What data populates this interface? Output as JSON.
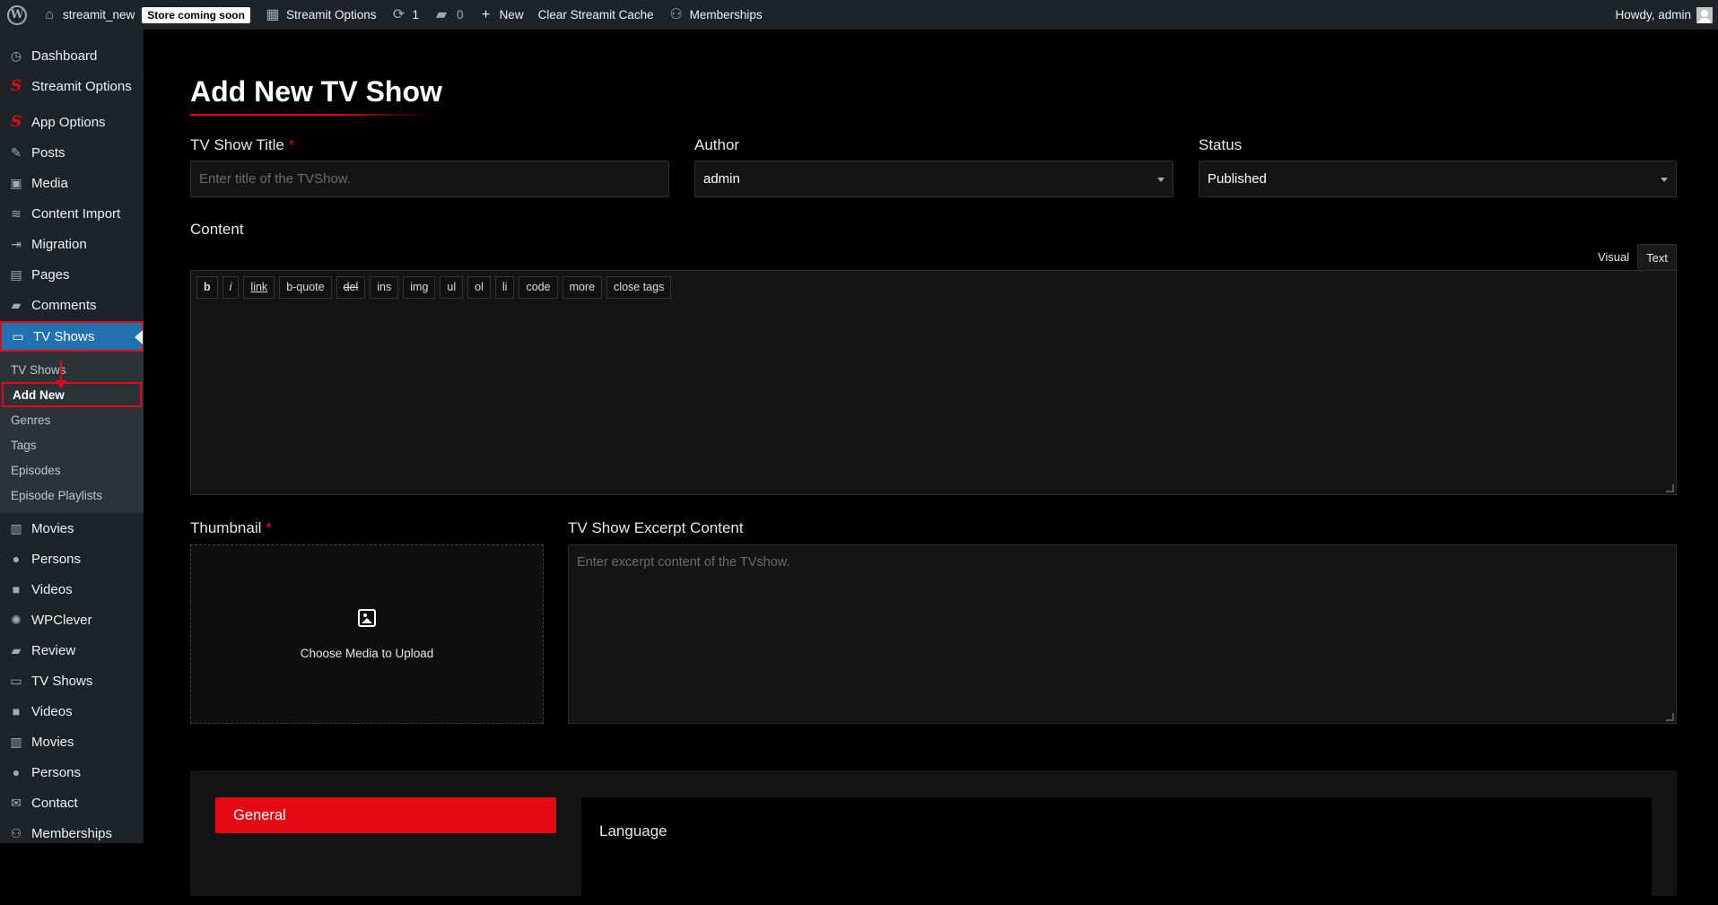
{
  "adminbar": {
    "site_name": "streamit_new",
    "store_badge": "Store coming soon",
    "streamit_options": "Streamit Options",
    "updates_count": "1",
    "comments_count": "0",
    "new_label": "New",
    "clear_cache": "Clear Streamit Cache",
    "memberships": "Memberships",
    "howdy": "Howdy, admin"
  },
  "sidebar": {
    "items_top": [
      {
        "label": "Dashboard",
        "icon": "dashboard-icon",
        "glyph": "◷"
      },
      {
        "label": "Streamit Options",
        "icon": "streamit-s-icon",
        "glyph": "S"
      },
      {
        "label": "App Options",
        "icon": "streamit-s-icon",
        "glyph": "S"
      },
      {
        "label": "Posts",
        "icon": "pushpin-icon",
        "glyph": "✎"
      },
      {
        "label": "Media",
        "icon": "media-icon",
        "glyph": "▣"
      },
      {
        "label": "Content Import",
        "icon": "database-icon",
        "glyph": "≋"
      },
      {
        "label": "Migration",
        "icon": "migrate-icon",
        "glyph": "⇥"
      },
      {
        "label": "Pages",
        "icon": "pages-icon",
        "glyph": "▤"
      },
      {
        "label": "Comments",
        "icon": "comment-icon",
        "glyph": "▰"
      }
    ],
    "active": {
      "label": "TV Shows",
      "icon": "tv-icon",
      "glyph": "▭"
    },
    "submenu": [
      "TV Shows",
      "Add New",
      "Genres",
      "Tags",
      "Episodes",
      "Episode Playlists"
    ],
    "items_bottom": [
      {
        "label": "Movies",
        "icon": "film-icon",
        "glyph": "▥"
      },
      {
        "label": "Persons",
        "icon": "person-icon",
        "glyph": "●"
      },
      {
        "label": "Videos",
        "icon": "video-icon",
        "glyph": "■"
      },
      {
        "label": "WPClever",
        "icon": "lightbulb-icon",
        "glyph": "✺"
      },
      {
        "label": "Review",
        "icon": "comment-icon",
        "glyph": "▰"
      },
      {
        "label": "TV Shows",
        "icon": "tv-icon",
        "glyph": "▭"
      },
      {
        "label": "Videos",
        "icon": "video-icon",
        "glyph": "■"
      },
      {
        "label": "Movies",
        "icon": "film-icon",
        "glyph": "▥"
      },
      {
        "label": "Persons",
        "icon": "person-icon",
        "glyph": "●"
      },
      {
        "label": "Contact",
        "icon": "mail-icon",
        "glyph": "✉"
      },
      {
        "label": "Memberships",
        "icon": "groups-icon",
        "glyph": "⚇"
      }
    ]
  },
  "page": {
    "title": "Add New TV Show",
    "title_label": "TV Show Title",
    "required_mark": "*",
    "title_placeholder": "Enter title of the TVShow.",
    "author_label": "Author",
    "author_value": "admin",
    "status_label": "Status",
    "status_value": "Published",
    "content_label": "Content",
    "tab_visual": "Visual",
    "tab_text": "Text",
    "quicktags": [
      "b",
      "i",
      "link",
      "b-quote",
      "del",
      "ins",
      "img",
      "ul",
      "ol",
      "li",
      "code",
      "more",
      "close tags"
    ],
    "thumbnail_label": "Thumbnail",
    "thumbnail_text": "Choose Media to Upload",
    "excerpt_label": "TV Show Excerpt Content",
    "excerpt_placeholder": "Enter excerpt content of the TVshow.",
    "general_tab": "General",
    "language_label": "Language"
  },
  "colors": {
    "accent": "#e50914",
    "wp_blue": "#2271b1",
    "admin_bg": "#1d2327"
  }
}
